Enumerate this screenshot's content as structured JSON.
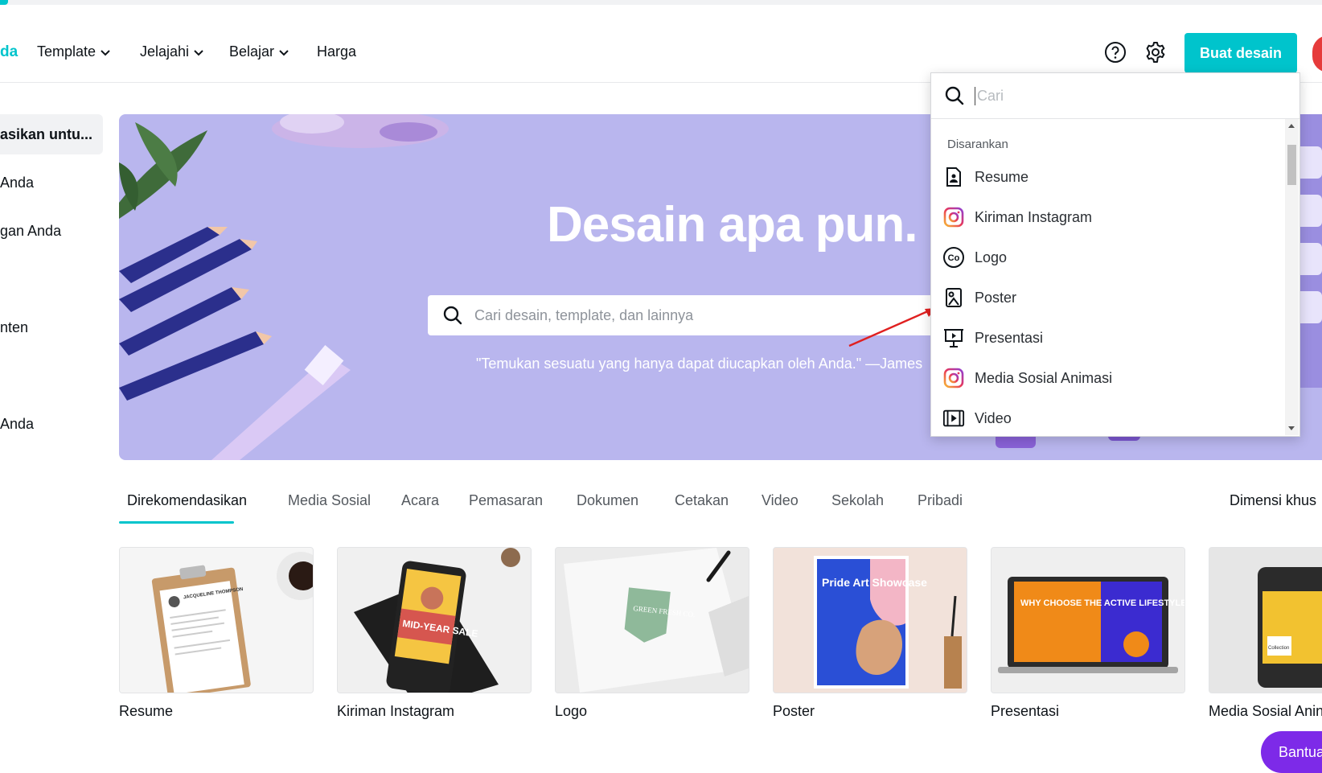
{
  "header": {
    "logo_fragment": "da",
    "nav": [
      {
        "label": "Template"
      },
      {
        "label": "Jelajahi"
      },
      {
        "label": "Belajar"
      },
      {
        "label": "Harga"
      }
    ],
    "create_button": "Buat desain",
    "help_icon": "help-circle-icon",
    "settings_icon": "gear-icon"
  },
  "sidebar": {
    "items": [
      {
        "label": "asikan untu..."
      },
      {
        "label": "Anda"
      },
      {
        "label": "gan Anda"
      },
      {
        "label": "nten"
      },
      {
        "label": "Anda"
      }
    ]
  },
  "hero": {
    "title": "Desain apa pun.",
    "search_placeholder": "Cari desain, template, dan lainnya",
    "quote": "\"Temukan sesuatu yang hanya dapat diucapkan oleh Anda.\" —James"
  },
  "dropdown": {
    "search_placeholder": "Cari",
    "section_title": "Disarankan",
    "items": [
      {
        "label": "Resume",
        "icon": "resume-icon"
      },
      {
        "label": "Kiriman Instagram",
        "icon": "instagram-icon"
      },
      {
        "label": "Logo",
        "icon": "logo-co-icon"
      },
      {
        "label": "Poster",
        "icon": "poster-icon"
      },
      {
        "label": "Presentasi",
        "icon": "presentation-icon"
      },
      {
        "label": "Media Sosial Animasi",
        "icon": "instagram-icon"
      },
      {
        "label": "Video",
        "icon": "video-icon"
      }
    ]
  },
  "tabs": {
    "items": [
      {
        "label": "Direkomendasikan"
      },
      {
        "label": "Media Sosial"
      },
      {
        "label": "Acara"
      },
      {
        "label": "Pemasaran"
      },
      {
        "label": "Dokumen"
      },
      {
        "label": "Cetakan"
      },
      {
        "label": "Video"
      },
      {
        "label": "Sekolah"
      },
      {
        "label": "Pribadi"
      }
    ],
    "active": "Direkomendasikan",
    "custom_size": "Dimensi khus"
  },
  "cards": {
    "items": [
      {
        "label": "Resume",
        "thumb_text": "JACQUELINE THOMPSON"
      },
      {
        "label": "Kiriman Instagram",
        "thumb_text": "MID-YEAR SALE"
      },
      {
        "label": "Logo",
        "thumb_text": "GREEN FRESH CO."
      },
      {
        "label": "Poster",
        "thumb_text": "Pride Art Showcase"
      },
      {
        "label": "Presentasi",
        "thumb_text": "WHY CHOOSE THE ACTIVE LIFESTYLE"
      },
      {
        "label": "Media Sosial Anin",
        "thumb_text": "Collection"
      }
    ]
  },
  "help_pill": "Bantua",
  "colors": {
    "accent": "#00c4cc",
    "hero_bg": "#b9b6ee",
    "help_pill": "#7d2ae8",
    "pencil": "#2b2f8c",
    "annotation_arrow": "#e02020"
  }
}
